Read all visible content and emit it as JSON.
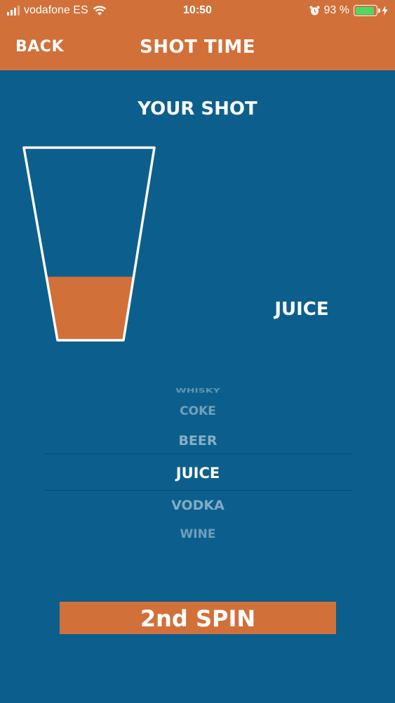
{
  "status_bar": {
    "carrier": "vodafone ES",
    "time": "10:50",
    "battery_percent": "93 %",
    "battery_level": 0.93
  },
  "nav": {
    "back_label": "BACK",
    "title": "SHOT TIME"
  },
  "main": {
    "heading": "YOUR SHOT",
    "glass_fill_level": 0.33,
    "selected_drink": "JUICE"
  },
  "picker": {
    "items": [
      "WHISKY",
      "COKE",
      "BEER",
      "JUICE",
      "VODKA",
      "WINE"
    ],
    "selected_index": 3
  },
  "spin_button": {
    "label": "2nd SPIN"
  },
  "colors": {
    "accent": "#d2703a",
    "background": "#0c5f8c",
    "battery": "#4cd964"
  }
}
